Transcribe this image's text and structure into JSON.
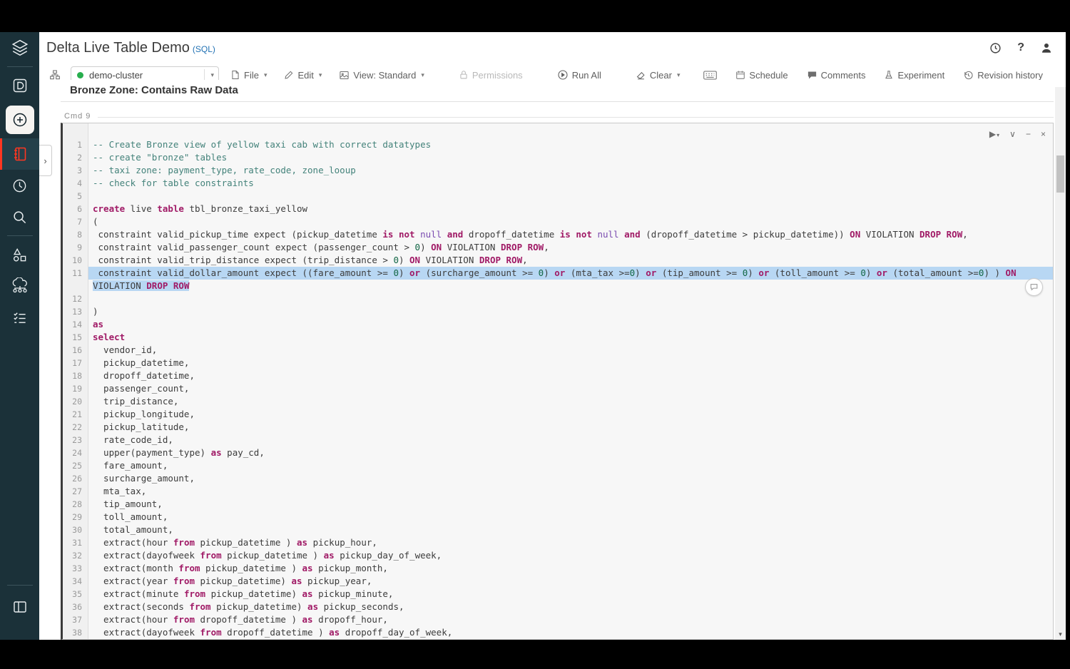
{
  "app": {
    "title": "Delta Live Table Demo",
    "title_suffix": "(SQL)",
    "help_glyph": "?"
  },
  "cluster": {
    "name": "demo-cluster",
    "status_color": "#27ae4d"
  },
  "menus": {
    "file": "File",
    "edit": "Edit",
    "view": "View: Standard",
    "permissions": "Permissions",
    "run_all": "Run All",
    "clear": "Clear"
  },
  "actions": {
    "schedule": "Schedule",
    "comments": "Comments",
    "experiment": "Experiment",
    "revision_history": "Revision history"
  },
  "sidebar": {
    "icons": [
      "databricks-logo",
      "workspace-d",
      "create-plus",
      "notebook",
      "recents-clock",
      "search",
      "data-shapes",
      "compute-cloud",
      "jobs-checklist",
      "panel-toggle"
    ],
    "active_color": "#ff3621",
    "background": "#1b3139"
  },
  "notebook": {
    "heading": "Bronze Zone: Contains Raw Data",
    "cmd_label": "Cmd 9",
    "expand_glyph": "›"
  },
  "cell_controls": {
    "run_glyph": "▶",
    "run_caret": "▾",
    "collapse_glyph": "∨",
    "minimize_glyph": "−",
    "close_glyph": "×"
  },
  "colors": {
    "keyword": "#a01a66",
    "comment": "#43827a",
    "atom": "#7a4bb0",
    "number": "#116644",
    "plain": "#3c3c3c",
    "selection": "#b8d7f3",
    "sidebar_bg": "#1b3139",
    "accent_red": "#ff3621",
    "link_blue": "#2272b4"
  },
  "code": {
    "lines": [
      {
        "n": "1",
        "segs": [
          [
            "c",
            "-- Create Bronze view of yellow taxi cab with correct datatypes"
          ]
        ]
      },
      {
        "n": "2",
        "segs": [
          [
            "c",
            "-- create \"bronze\" tables"
          ]
        ]
      },
      {
        "n": "3",
        "segs": [
          [
            "c",
            "-- taxi zone: payment_type, rate_code, zone_looup"
          ]
        ]
      },
      {
        "n": "4",
        "segs": [
          [
            "c",
            "-- check for table constraints"
          ]
        ]
      },
      {
        "n": "5",
        "segs": []
      },
      {
        "n": "6",
        "segs": [
          [
            "k",
            "create"
          ],
          [
            "p",
            " live "
          ],
          [
            "k",
            "table"
          ],
          [
            "p",
            " tbl_bronze_taxi_yellow"
          ]
        ]
      },
      {
        "n": "7",
        "segs": [
          [
            "p",
            "("
          ]
        ]
      },
      {
        "n": "8",
        "segs": [
          [
            "p",
            " constraint valid_pickup_time expect (pickup_datetime "
          ],
          [
            "k",
            "is not"
          ],
          [
            "p",
            " "
          ],
          [
            "a",
            "null"
          ],
          [
            "p",
            " "
          ],
          [
            "k",
            "and"
          ],
          [
            "p",
            " dropoff_datetime "
          ],
          [
            "k",
            "is not"
          ],
          [
            "p",
            " "
          ],
          [
            "a",
            "null"
          ],
          [
            "p",
            " "
          ],
          [
            "k",
            "and"
          ],
          [
            "p",
            " (dropoff_datetime > pickup_datetime)) "
          ],
          [
            "k",
            "ON"
          ],
          [
            "p",
            " VIOLATION "
          ],
          [
            "k",
            "DROP ROW"
          ],
          [
            "p",
            ","
          ]
        ]
      },
      {
        "n": "9",
        "segs": [
          [
            "p",
            " constraint valid_passenger_count expect (passenger_count > "
          ],
          [
            "n",
            "0"
          ],
          [
            "p",
            ") "
          ],
          [
            "k",
            "ON"
          ],
          [
            "p",
            " VIOLATION "
          ],
          [
            "k",
            "DROP ROW"
          ],
          [
            "p",
            ","
          ]
        ]
      },
      {
        "n": "10",
        "segs": [
          [
            "p",
            " constraint valid_trip_distance expect (trip_distance > "
          ],
          [
            "n",
            "0"
          ],
          [
            "p",
            ") "
          ],
          [
            "k",
            "ON"
          ],
          [
            "p",
            " VIOLATION "
          ],
          [
            "k",
            "DROP ROW"
          ],
          [
            "p",
            ","
          ]
        ]
      },
      {
        "n": "11",
        "selected": true,
        "wrap": [
          [
            [
              "p",
              " constraint valid_dollar_amount expect ((fare_amount >= "
            ],
            [
              "n",
              "0"
            ],
            [
              "p",
              ") "
            ],
            [
              "k",
              "or"
            ],
            [
              "p",
              " (surcharge_amount >= "
            ],
            [
              "n",
              "0"
            ],
            [
              "p",
              ") "
            ],
            [
              "k",
              "or"
            ],
            [
              "p",
              " (mta_tax >="
            ],
            [
              "n",
              "0"
            ],
            [
              "p",
              ") "
            ],
            [
              "k",
              "or"
            ],
            [
              "p",
              " (tip_amount >= "
            ],
            [
              "n",
              "0"
            ],
            [
              "p",
              ") "
            ],
            [
              "k",
              "or"
            ],
            [
              "p",
              " (toll_amount >= "
            ],
            [
              "n",
              "0"
            ],
            [
              "p",
              ") "
            ],
            [
              "k",
              "or"
            ],
            [
              "p",
              " (total_amount >="
            ],
            [
              "n",
              "0"
            ],
            [
              "p",
              ") ) "
            ],
            [
              "k",
              "ON"
            ]
          ],
          [
            [
              "p",
              "VIOLATION "
            ],
            [
              "k",
              "DROP ROW"
            ]
          ]
        ]
      },
      {
        "n": "12",
        "segs": []
      },
      {
        "n": "13",
        "segs": [
          [
            "p",
            ")"
          ]
        ]
      },
      {
        "n": "14",
        "segs": [
          [
            "k",
            "as"
          ]
        ]
      },
      {
        "n": "15",
        "segs": [
          [
            "k",
            "select"
          ]
        ]
      },
      {
        "n": "16",
        "segs": [
          [
            "p",
            "  vendor_id,"
          ]
        ]
      },
      {
        "n": "17",
        "segs": [
          [
            "p",
            "  pickup_datetime,"
          ]
        ]
      },
      {
        "n": "18",
        "segs": [
          [
            "p",
            "  dropoff_datetime,"
          ]
        ]
      },
      {
        "n": "19",
        "segs": [
          [
            "p",
            "  passenger_count,"
          ]
        ]
      },
      {
        "n": "20",
        "segs": [
          [
            "p",
            "  trip_distance,"
          ]
        ]
      },
      {
        "n": "21",
        "segs": [
          [
            "p",
            "  pickup_longitude,"
          ]
        ]
      },
      {
        "n": "22",
        "segs": [
          [
            "p",
            "  pickup_latitude,"
          ]
        ]
      },
      {
        "n": "23",
        "segs": [
          [
            "p",
            "  rate_code_id,"
          ]
        ]
      },
      {
        "n": "24",
        "segs": [
          [
            "p",
            "  upper(payment_type) "
          ],
          [
            "k",
            "as"
          ],
          [
            "p",
            " pay_cd,"
          ]
        ]
      },
      {
        "n": "25",
        "segs": [
          [
            "p",
            "  fare_amount,"
          ]
        ]
      },
      {
        "n": "26",
        "segs": [
          [
            "p",
            "  surcharge_amount,"
          ]
        ]
      },
      {
        "n": "27",
        "segs": [
          [
            "p",
            "  mta_tax,"
          ]
        ]
      },
      {
        "n": "28",
        "segs": [
          [
            "p",
            "  tip_amount,"
          ]
        ]
      },
      {
        "n": "29",
        "segs": [
          [
            "p",
            "  toll_amount,"
          ]
        ]
      },
      {
        "n": "30",
        "segs": [
          [
            "p",
            "  total_amount,"
          ]
        ]
      },
      {
        "n": "31",
        "segs": [
          [
            "p",
            "  extract(hour "
          ],
          [
            "k",
            "from"
          ],
          [
            "p",
            " pickup_datetime ) "
          ],
          [
            "k",
            "as"
          ],
          [
            "p",
            " pickup_hour,"
          ]
        ]
      },
      {
        "n": "32",
        "segs": [
          [
            "p",
            "  extract(dayofweek "
          ],
          [
            "k",
            "from"
          ],
          [
            "p",
            " pickup_datetime ) "
          ],
          [
            "k",
            "as"
          ],
          [
            "p",
            " pickup_day_of_week,"
          ]
        ]
      },
      {
        "n": "33",
        "segs": [
          [
            "p",
            "  extract(month "
          ],
          [
            "k",
            "from"
          ],
          [
            "p",
            " pickup_datetime ) "
          ],
          [
            "k",
            "as"
          ],
          [
            "p",
            " pickup_month,"
          ]
        ]
      },
      {
        "n": "34",
        "segs": [
          [
            "p",
            "  extract(year "
          ],
          [
            "k",
            "from"
          ],
          [
            "p",
            " pickup_datetime) "
          ],
          [
            "k",
            "as"
          ],
          [
            "p",
            " pickup_year,"
          ]
        ]
      },
      {
        "n": "35",
        "segs": [
          [
            "p",
            "  extract(minute "
          ],
          [
            "k",
            "from"
          ],
          [
            "p",
            " pickup_datetime) "
          ],
          [
            "k",
            "as"
          ],
          [
            "p",
            " pickup_minute,"
          ]
        ]
      },
      {
        "n": "36",
        "segs": [
          [
            "p",
            "  extract(seconds "
          ],
          [
            "k",
            "from"
          ],
          [
            "p",
            " pickup_datetime) "
          ],
          [
            "k",
            "as"
          ],
          [
            "p",
            " pickup_seconds,"
          ]
        ]
      },
      {
        "n": "37",
        "segs": [
          [
            "p",
            "  extract(hour "
          ],
          [
            "k",
            "from"
          ],
          [
            "p",
            " dropoff_datetime ) "
          ],
          [
            "k",
            "as"
          ],
          [
            "p",
            " dropoff_hour,"
          ]
        ]
      },
      {
        "n": "38",
        "segs": [
          [
            "p",
            "  extract(dayofweek "
          ],
          [
            "k",
            "from"
          ],
          [
            "p",
            " dropoff_datetime ) "
          ],
          [
            "k",
            "as"
          ],
          [
            "p",
            " dropoff_day_of_week,"
          ]
        ]
      }
    ]
  }
}
